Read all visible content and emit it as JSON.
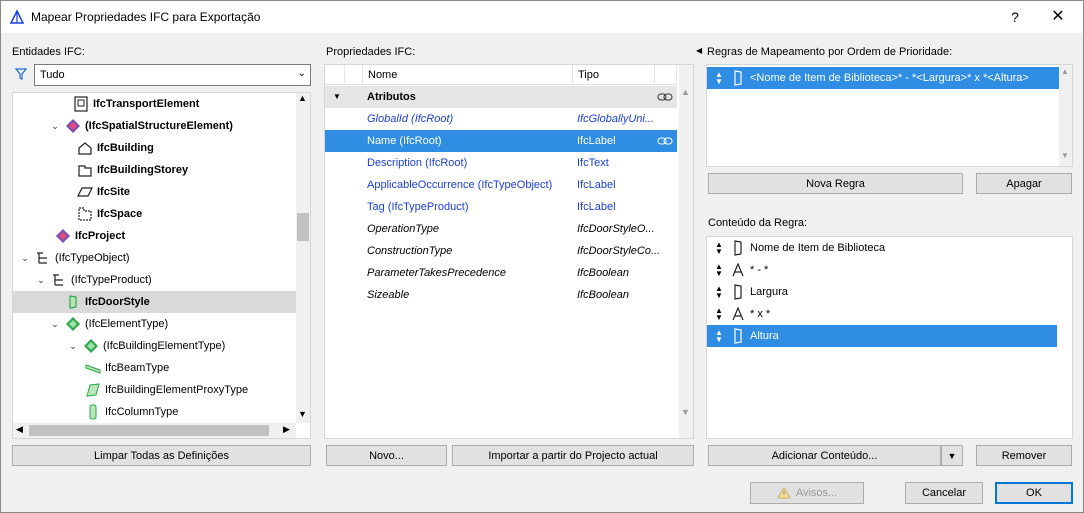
{
  "window": {
    "title": "Mapear Propriedades IFC para Exportação",
    "help_label": "?",
    "close_label": "✕"
  },
  "entities": {
    "label": "Entidades IFC:",
    "filter_value": "Tudo",
    "tree": [
      {
        "label": "IfcTransportElement",
        "bold": true
      },
      {
        "label": "(IfcSpatialStructureElement)",
        "bold": true
      },
      {
        "label": "IfcBuilding",
        "bold": true
      },
      {
        "label": "IfcBuildingStorey",
        "bold": true
      },
      {
        "label": "IfcSite",
        "bold": true
      },
      {
        "label": "IfcSpace",
        "bold": true
      },
      {
        "label": "IfcProject",
        "bold": true
      },
      {
        "label": "(IfcTypeObject)",
        "bold": false
      },
      {
        "label": "(IfcTypeProduct)",
        "bold": false
      },
      {
        "label": "IfcDoorStyle",
        "bold": true
      },
      {
        "label": "(IfcElementType)",
        "bold": false
      },
      {
        "label": "(IfcBuildingElementType)",
        "bold": false
      },
      {
        "label": "IfcBeamType",
        "bold": false
      },
      {
        "label": "IfcBuildingElementProxyType",
        "bold": false
      },
      {
        "label": "IfcColumnType",
        "bold": false
      }
    ],
    "clear_button": "Limpar Todas as Definições"
  },
  "properties": {
    "label": "Propriedades IFC:",
    "col_name": "Nome",
    "col_type": "Tipo",
    "group": "Atributos",
    "rows": [
      {
        "name": "GlobalId (IfcRoot)",
        "type": "IfcGloballyUni..."
      },
      {
        "name": "Name (IfcRoot)",
        "type": "IfcLabel"
      },
      {
        "name": "Description (IfcRoot)",
        "type": "IfcText"
      },
      {
        "name": "ApplicableOccurrence (IfcTypeObject)",
        "type": "IfcLabel"
      },
      {
        "name": "Tag (IfcTypeProduct)",
        "type": "IfcLabel"
      },
      {
        "name": "OperationType",
        "type": "IfcDoorStyleO..."
      },
      {
        "name": "ConstructionType",
        "type": "IfcDoorStyleCo..."
      },
      {
        "name": "ParameterTakesPrecedence",
        "type": "IfcBoolean"
      },
      {
        "name": "Sizeable",
        "type": "IfcBoolean"
      }
    ],
    "new_button": "Novo...",
    "import_button": "Importar a partir do Projecto actual"
  },
  "rules": {
    "label": "Regras de Mapeamento por Ordem de Prioridade:",
    "items": [
      "<Nome de Item de Biblioteca>* - *<Largura>* x *<Altura>"
    ],
    "new_rule_button": "Nova Regra",
    "delete_button": "Apagar",
    "content_label": "Conteúdo da Regra:",
    "content_items": [
      "Nome de Item de Biblioteca",
      "* - *",
      "Largura",
      "* x *",
      "Altura"
    ],
    "add_content_button": "Adicionar Conteúdo...",
    "remove_button": "Remover"
  },
  "footer": {
    "warnings_button": "Avisos...",
    "cancel_button": "Cancelar",
    "ok_button": "OK"
  },
  "colors": {
    "selection": "#2f8ee4",
    "link_blue": "#1a3fd6",
    "ifc_green": "#2aa84a",
    "ifc_purple": "#7a4fb5"
  }
}
